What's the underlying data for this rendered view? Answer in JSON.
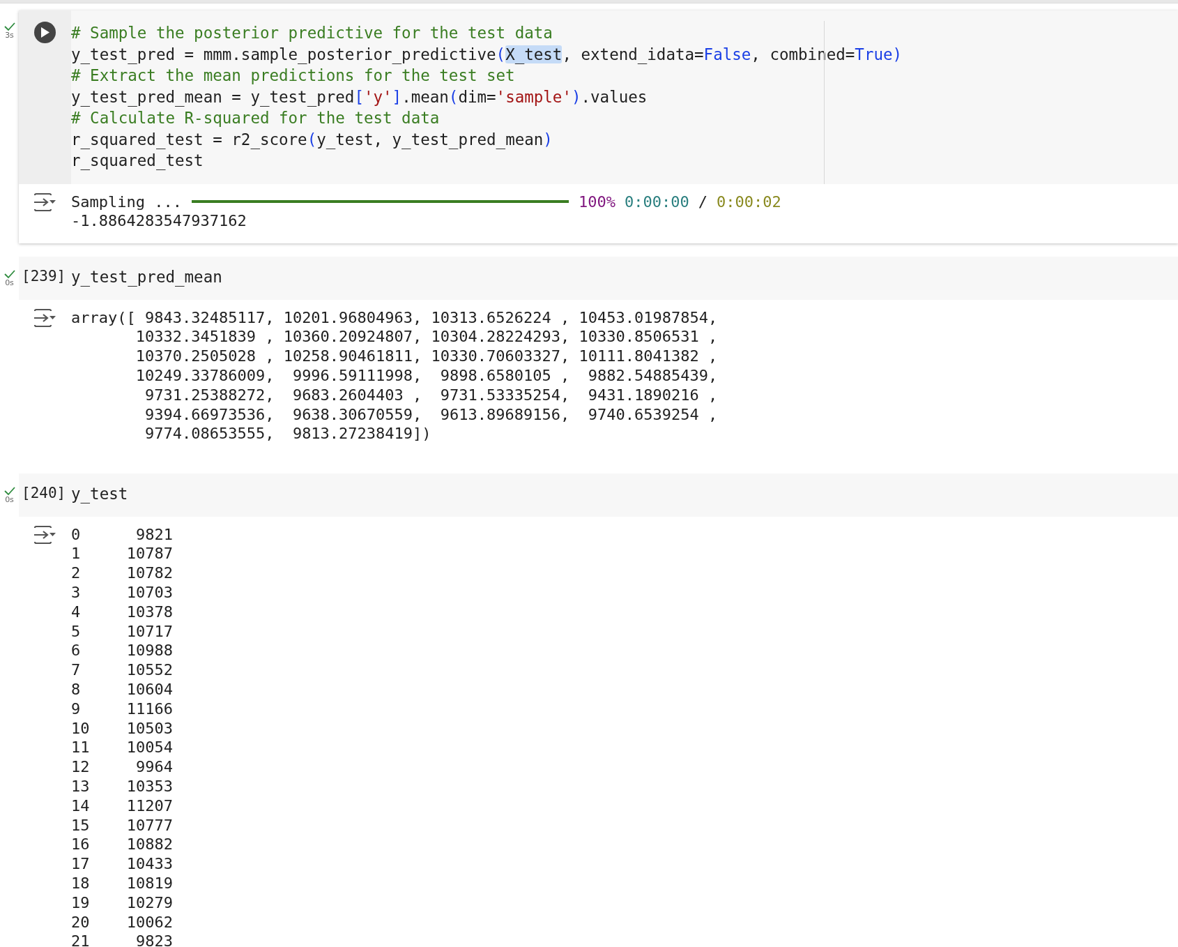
{
  "cells": [
    {
      "kind": "run_button",
      "duration": "3s",
      "code_lines": [
        [
          {
            "text": "# Sample the posterior predictive for the test data",
            "kind": "comment"
          }
        ],
        [
          {
            "text": "y_test_pred = mmm.sample_posterior_predictive",
            "kind": "plain"
          },
          {
            "text": "(",
            "kind": "paren"
          },
          {
            "text": "X_test",
            "kind": "highlight"
          },
          {
            "text": ", extend_idata=",
            "kind": "plain"
          },
          {
            "text": "False",
            "kind": "keyword"
          },
          {
            "text": ", combined=",
            "kind": "plain"
          },
          {
            "text": "True",
            "kind": "keyword"
          },
          {
            "text": ")",
            "kind": "paren"
          }
        ],
        [
          {
            "text": "# Extract the mean predictions for the test set",
            "kind": "comment"
          }
        ],
        [
          {
            "text": "y_test_pred_mean = y_test_pred",
            "kind": "plain"
          },
          {
            "text": "[",
            "kind": "paren"
          },
          {
            "text": "'y'",
            "kind": "string"
          },
          {
            "text": "]",
            "kind": "paren"
          },
          {
            "text": ".mean",
            "kind": "plain"
          },
          {
            "text": "(",
            "kind": "paren"
          },
          {
            "text": "dim=",
            "kind": "plain"
          },
          {
            "text": "'sample'",
            "kind": "string"
          },
          {
            "text": ")",
            "kind": "paren"
          },
          {
            "text": ".values",
            "kind": "plain"
          }
        ],
        [
          {
            "text": "# Calculate R-squared for the test data",
            "kind": "comment"
          }
        ],
        [
          {
            "text": "r_squared_test = r2_score",
            "kind": "plain"
          },
          {
            "text": "(",
            "kind": "paren"
          },
          {
            "text": "y_test, y_test_pred_mean",
            "kind": "plain"
          },
          {
            "text": ")",
            "kind": "paren"
          }
        ],
        [
          {
            "text": "r_squared_test",
            "kind": "plain"
          }
        ]
      ],
      "output": {
        "kind": "progress",
        "label": "Sampling ...",
        "level": 1,
        "percent": "100%",
        "elapsed": "0:00:00",
        "separator": "/",
        "remaining": "0:00:02",
        "result": "-1.8864283547937162"
      }
    },
    {
      "kind": "count",
      "duration": "0s",
      "count": "[239]",
      "code_lines": [
        [
          {
            "text": "y_test_pred_mean",
            "kind": "plain"
          }
        ]
      ],
      "output": {
        "kind": "text",
        "lines": [
          "array([ 9843.32485117, 10201.96804963, 10313.6526224 , 10453.01987854,",
          "       10332.3451839 , 10360.20924807, 10304.28224293, 10330.8506531 ,",
          "       10370.2505028 , 10258.90461811, 10330.70603327, 10111.8041382 ,",
          "       10249.33786009,  9996.59111998,  9898.6580105 ,  9882.54885439,",
          "        9731.25388272,  9683.2604403 ,  9731.53335254,  9431.1890216 ,",
          "        9394.66973536,  9638.30670559,  9613.89689156,  9740.6539254 ,",
          "        9774.08653555,  9813.27238419])"
        ]
      }
    },
    {
      "kind": "count",
      "duration": "0s",
      "count": "[240]",
      "code_lines": [
        [
          {
            "text": "y_test",
            "kind": "plain"
          }
        ]
      ],
      "output": {
        "kind": "series",
        "rows": [
          {
            "index": "0",
            "value": "9821"
          },
          {
            "index": "1",
            "value": "10787"
          },
          {
            "index": "2",
            "value": "10782"
          },
          {
            "index": "3",
            "value": "10703"
          },
          {
            "index": "4",
            "value": "10378"
          },
          {
            "index": "5",
            "value": "10717"
          },
          {
            "index": "6",
            "value": "10988"
          },
          {
            "index": "7",
            "value": "10552"
          },
          {
            "index": "8",
            "value": "10604"
          },
          {
            "index": "9",
            "value": "11166"
          },
          {
            "index": "10",
            "value": "10503"
          },
          {
            "index": "11",
            "value": "10054"
          },
          {
            "index": "12",
            "value": "9964"
          },
          {
            "index": "13",
            "value": "10353"
          },
          {
            "index": "14",
            "value": "11207"
          },
          {
            "index": "15",
            "value": "10777"
          },
          {
            "index": "16",
            "value": "10882"
          },
          {
            "index": "17",
            "value": "10433"
          },
          {
            "index": "18",
            "value": "10819"
          },
          {
            "index": "19",
            "value": "10279"
          },
          {
            "index": "20",
            "value": "10062"
          },
          {
            "index": "21",
            "value": "9823"
          }
        ]
      }
    }
  ]
}
